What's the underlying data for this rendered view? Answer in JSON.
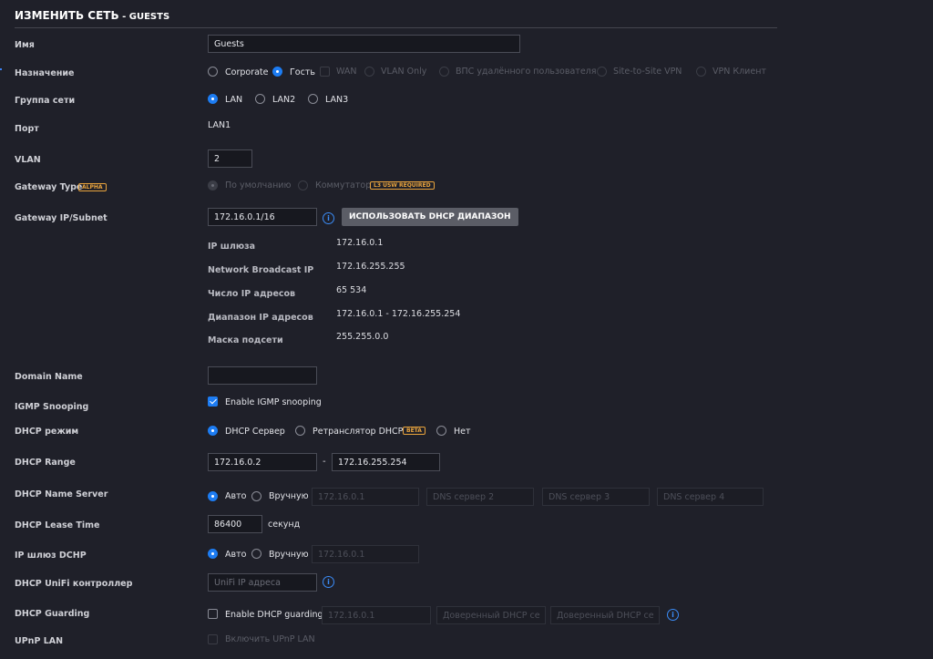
{
  "header": {
    "title_main": "ИЗМЕНИТЬ СЕТЬ",
    "title_suffix": "- GUESTS"
  },
  "name": {
    "label": "Имя",
    "value": "Guests"
  },
  "purpose": {
    "label": "Назначение",
    "options": [
      "Corporate",
      "Гость",
      "WAN",
      "VLAN Only",
      "ВПС удалённого пользователя",
      "Site-to-Site VPN",
      "VPN Клиент"
    ],
    "selected": "Гость"
  },
  "network_group": {
    "label": "Группа сети",
    "options": [
      "LAN",
      "LAN2",
      "LAN3"
    ],
    "selected": "LAN"
  },
  "port": {
    "label": "Порт",
    "value": "LAN1"
  },
  "vlan": {
    "label": "VLAN",
    "value": "2"
  },
  "gateway_type": {
    "label": "Gateway Type",
    "badge": "ALPHA",
    "options": [
      "По умолчанию",
      "Коммутатор"
    ],
    "switch_badge": "L3 USW REQUIRED"
  },
  "gateway_subnet": {
    "label": "Gateway IP/Subnet",
    "value": "172.16.0.1/16",
    "button": "ИСПОЛЬЗОВАТЬ DHCP ДИАПАЗОН",
    "info": [
      {
        "label": "IP шлюза",
        "value": "172.16.0.1"
      },
      {
        "label": "Network Broadcast IP",
        "value": "172.16.255.255"
      },
      {
        "label": "Число IP адресов",
        "value": "65 534"
      },
      {
        "label": "Диапазон IP адресов",
        "value": "172.16.0.1 - 172.16.255.254"
      },
      {
        "label": "Маска подсети",
        "value": "255.255.0.0"
      }
    ]
  },
  "domain_name": {
    "label": "Domain Name",
    "value": ""
  },
  "igmp": {
    "label": "IGMP Snooping",
    "checkbox_label": "Enable IGMP snooping",
    "checked": true
  },
  "dhcp_mode": {
    "label": "DHCP режим",
    "options": [
      "DHCP Сервер",
      "Ретранслятор DHCP",
      "Нет"
    ],
    "relay_badge": "BETA",
    "selected": "DHCP Сервер"
  },
  "dhcp_range": {
    "label": "DHCP Range",
    "start": "172.16.0.2",
    "separator": "-",
    "end": "172.16.255.254"
  },
  "dhcp_dns": {
    "label": "DHCP Name Server",
    "options": [
      "Авто",
      "Вручную"
    ],
    "selected": "Авто",
    "placeholders": [
      "172.16.0.1",
      "DNS сервер 2",
      "DNS сервер 3",
      "DNS сервер 4"
    ]
  },
  "lease": {
    "label": "DHCP Lease Time",
    "value": "86400",
    "unit": "секунд"
  },
  "dhcp_gateway": {
    "label": "IP шлюз DCHP",
    "options": [
      "Авто",
      "Вручную"
    ],
    "selected": "Авто",
    "placeholder": "172.16.0.1"
  },
  "unifi_controller": {
    "label": "DHCP UniFi контроллер",
    "placeholder": "UniFi IP адреса"
  },
  "dhcp_guarding": {
    "label": "DHCP Guarding",
    "checkbox_label": "Enable DHCP guarding",
    "placeholders": [
      "172.16.0.1",
      "Доверенный DHCP серв",
      "Доверенный DHCP серв"
    ]
  },
  "upnp": {
    "label": "UPnP LAN",
    "checkbox_label": "Включить UPnP LAN"
  },
  "colors": {
    "background": "#1f2029",
    "accent": "#1d7cf2",
    "badge": "#e8a33d",
    "button": "#5b5d66"
  }
}
